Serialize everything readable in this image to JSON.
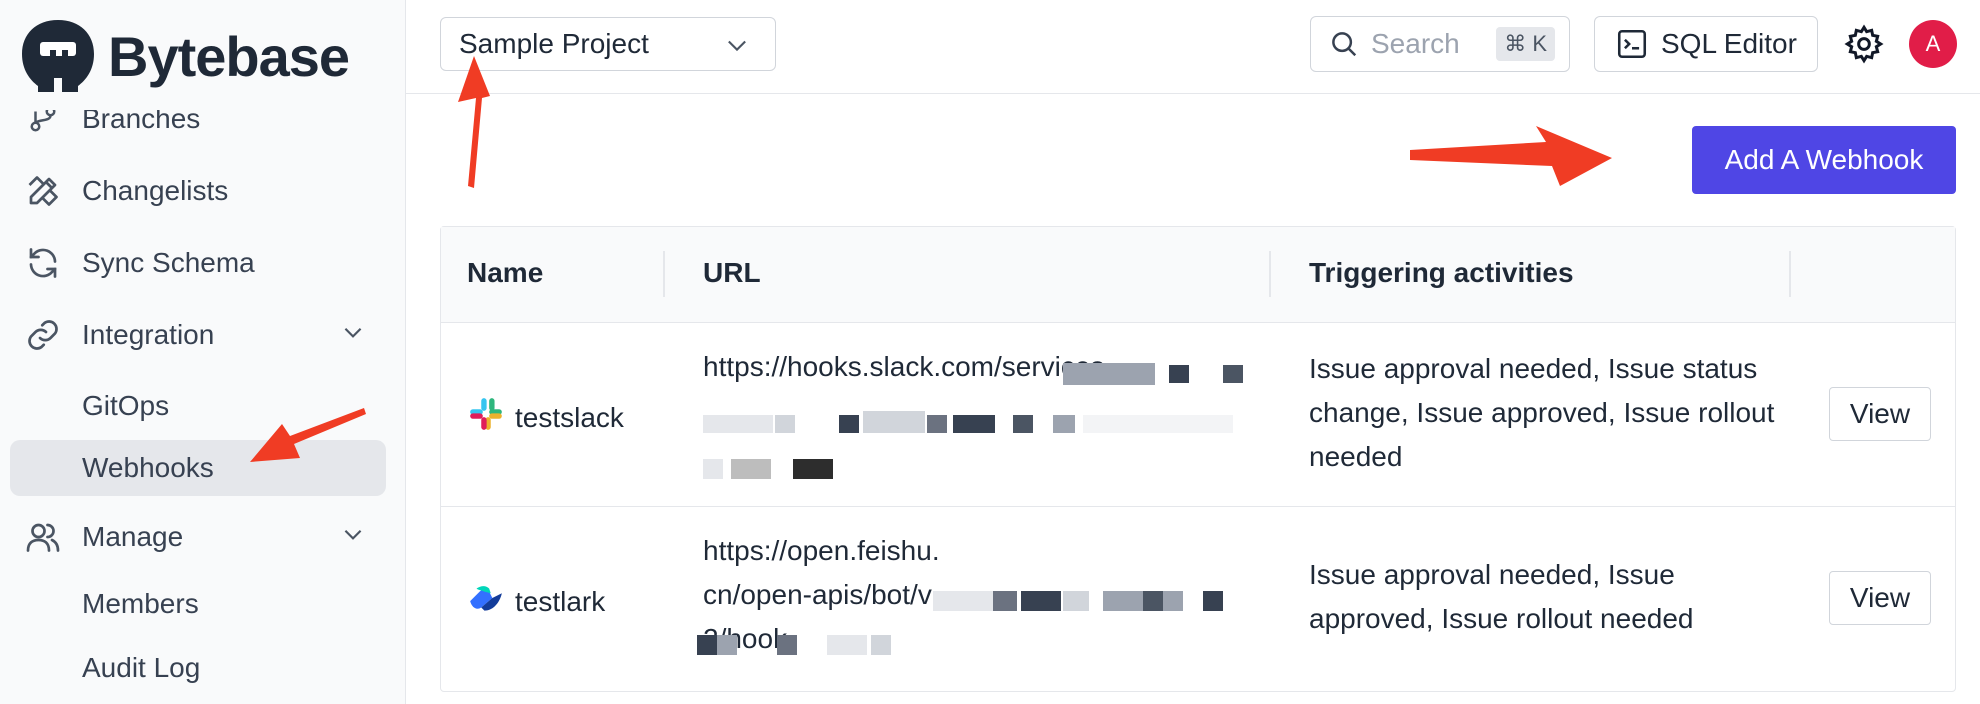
{
  "brand": {
    "name": "Bytebase"
  },
  "sidebar": {
    "items": [
      {
        "label": "Branches",
        "icon": "branch-icon"
      },
      {
        "label": "Changelists",
        "icon": "pencil-ruler-icon"
      },
      {
        "label": "Sync Schema",
        "icon": "refresh-icon"
      },
      {
        "label": "Integration",
        "icon": "link-icon",
        "expanded": true
      },
      {
        "label": "GitOps"
      },
      {
        "label": "Webhooks",
        "active": true
      },
      {
        "label": "Manage",
        "icon": "users-icon",
        "expanded": true
      },
      {
        "label": "Members"
      },
      {
        "label": "Audit Log"
      }
    ]
  },
  "header": {
    "project": "Sample Project",
    "search_placeholder": "Search",
    "search_shortcut": "⌘ K",
    "sql_editor": "SQL Editor",
    "avatar_letter": "A"
  },
  "main": {
    "add_button": "Add A Webhook",
    "table": {
      "headers": [
        "Name",
        "URL",
        "Triggering activities"
      ],
      "rows": [
        {
          "name": "testslack",
          "icon": "slack-icon",
          "url": "https://hooks.slack.com/services",
          "activities": "Issue approval needed, Issue status change, Issue approved, Issue rollout needed",
          "action": "View"
        },
        {
          "name": "testlark",
          "icon": "lark-icon",
          "url": "https://open.feishu.cn/open-apis/bot/v2/hook",
          "activities": "Issue approval needed, Issue approved, Issue rollout needed",
          "action": "View"
        }
      ]
    }
  },
  "colors": {
    "primary": "#4f46e5",
    "annotation": "#f03c24",
    "avatar": "#e11d48"
  }
}
